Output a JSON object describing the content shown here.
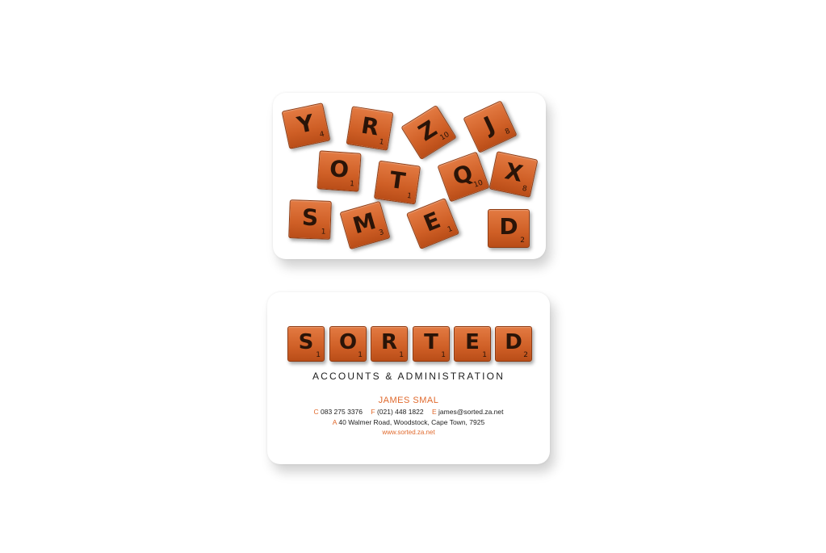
{
  "back_card": {
    "tiles": [
      {
        "letter": "Y",
        "score": "4"
      },
      {
        "letter": "R",
        "score": "1"
      },
      {
        "letter": "Z",
        "score": "10"
      },
      {
        "letter": "J",
        "score": "8"
      },
      {
        "letter": "O",
        "score": "1"
      },
      {
        "letter": "T",
        "score": "1"
      },
      {
        "letter": "Q",
        "score": "10"
      },
      {
        "letter": "X",
        "score": "8"
      },
      {
        "letter": "S",
        "score": "1"
      },
      {
        "letter": "M",
        "score": "3"
      },
      {
        "letter": "E",
        "score": "1"
      },
      {
        "letter": "D",
        "score": "2"
      }
    ]
  },
  "front_card": {
    "logo_tiles": [
      {
        "letter": "S",
        "score": "1"
      },
      {
        "letter": "O",
        "score": "1"
      },
      {
        "letter": "R",
        "score": "1"
      },
      {
        "letter": "T",
        "score": "1"
      },
      {
        "letter": "E",
        "score": "1"
      },
      {
        "letter": "D",
        "score": "2"
      }
    ],
    "tagline": "ACCOUNTS & ADMINISTRATION",
    "name": "JAMES SMAL",
    "contact": {
      "cell_label": "C",
      "cell": "083 275 3376",
      "fax_label": "F",
      "fax": "(021) 448 1822",
      "email_label": "E",
      "email": "james@sorted.za.net",
      "address_label": "A",
      "address": "40 Walmer Road, Woodstock, Cape Town, 7925"
    },
    "website": "www.sorted.za.net"
  },
  "colors": {
    "tile_orange": "#cf5f26",
    "accent_orange": "#e0692c",
    "text_dark": "#1d1d1d"
  }
}
